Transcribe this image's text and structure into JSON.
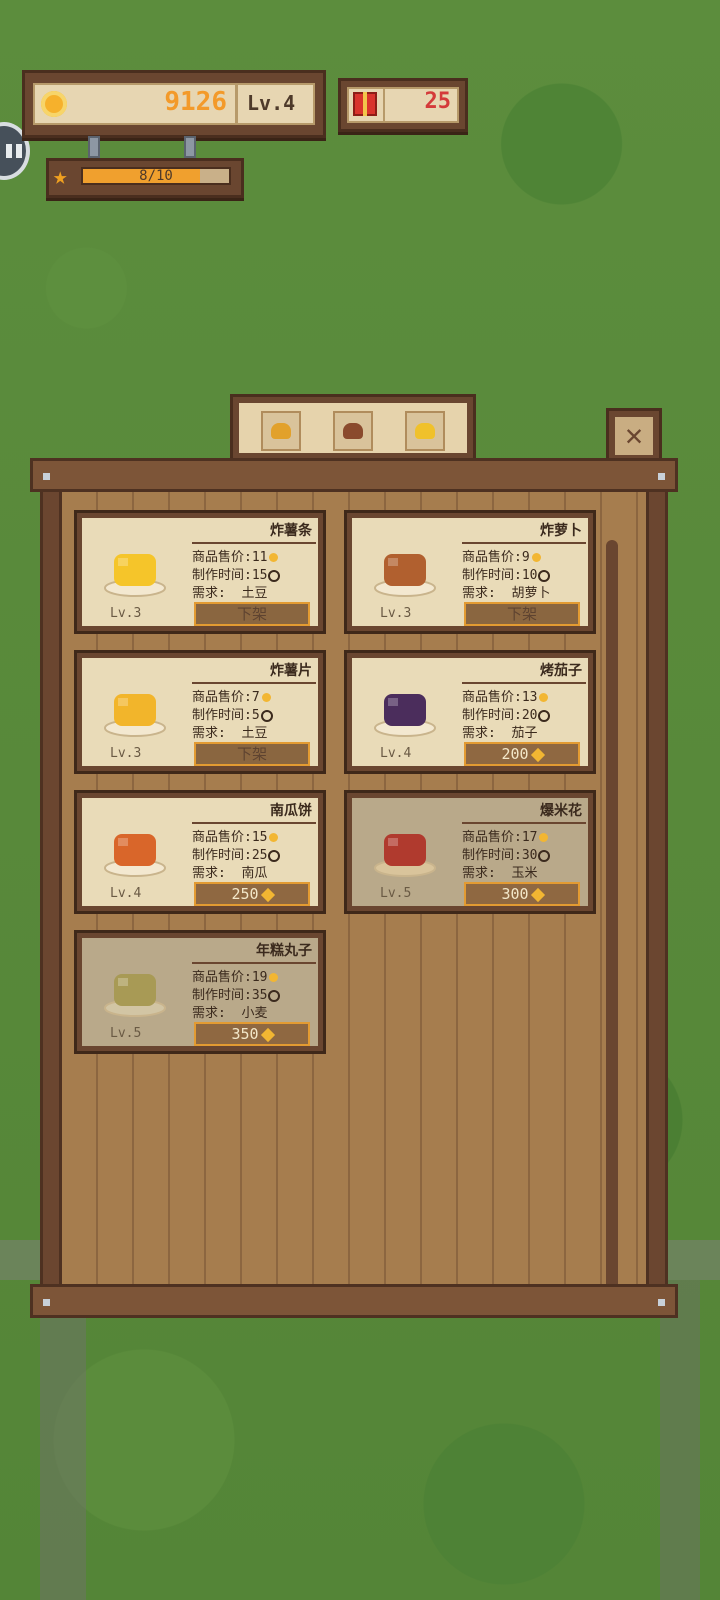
{
  "hud": {
    "coins": "9126",
    "level": "Lv.4",
    "gifts": "25",
    "xp_text": "8/10",
    "xp_fraction": 0.8
  },
  "tabs": [
    {
      "icon": "potato-dish-icon",
      "color": "#e2a12b"
    },
    {
      "icon": "meat-dish-icon",
      "color": "#8a4a2d"
    },
    {
      "icon": "fries-icon",
      "color": "#f0c12b"
    }
  ],
  "labels": {
    "price": "商品售价:",
    "time": "制作时间:",
    "need": "需求:"
  },
  "items": [
    {
      "name": "炸薯条",
      "price": "11",
      "time": "15",
      "need": "土豆",
      "level": "Lv.3",
      "button": "下架",
      "locked": false,
      "owned": true,
      "food_color": "#f5c52a",
      "plate": "#f3e8d0"
    },
    {
      "name": "炸萝卜",
      "price": "9",
      "time": "10",
      "need": "胡萝卜",
      "level": "Lv.3",
      "button": "下架",
      "locked": false,
      "owned": true,
      "food_color": "#b1602f",
      "plate": "#f3e8d0"
    },
    {
      "name": "炸薯片",
      "price": "7",
      "time": "5",
      "need": "土豆",
      "level": "Lv.3",
      "button": "下架",
      "locked": false,
      "owned": true,
      "food_color": "#f2b52b",
      "plate": "#f3e8d0"
    },
    {
      "name": "烤茄子",
      "price": "13",
      "time": "20",
      "need": "茄子",
      "level": "Lv.4",
      "button": "200",
      "locked": false,
      "owned": false,
      "food_color": "#4b2d5c",
      "plate": "#f3e8d0"
    },
    {
      "name": "南瓜饼",
      "price": "15",
      "time": "25",
      "need": "南瓜",
      "level": "Lv.4",
      "button": "250",
      "locked": false,
      "owned": false,
      "food_color": "#d9662a",
      "plate": "#f3e8d0"
    },
    {
      "name": "爆米花",
      "price": "17",
      "time": "30",
      "need": "玉米",
      "level": "Lv.5",
      "button": "300",
      "locked": true,
      "owned": false,
      "food_color": "#b03a2e",
      "plate": "#d9c49b"
    },
    {
      "name": "年糕丸子",
      "price": "19",
      "time": "35",
      "need": "小麦",
      "level": "Lv.5",
      "button": "350",
      "locked": true,
      "owned": false,
      "food_color": "#a89a55",
      "plate": "#d2c5a4"
    }
  ]
}
